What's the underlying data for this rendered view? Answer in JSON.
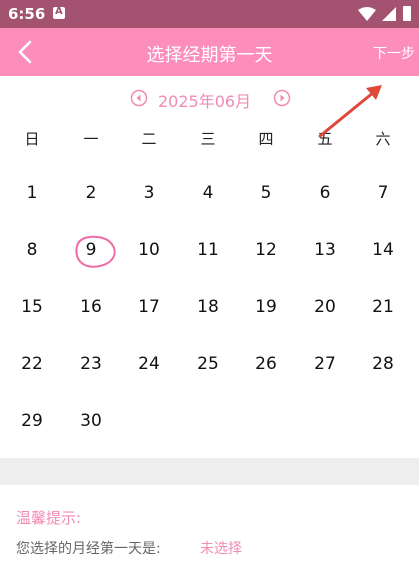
{
  "status": {
    "time": "6:56",
    "notif_letter": "A"
  },
  "toolbar": {
    "title": "选择经期第一天",
    "next_label": "下一步"
  },
  "calendar": {
    "month_label": "2025年06月",
    "weekdays": [
      "日",
      "一",
      "二",
      "三",
      "四",
      "五",
      "六"
    ],
    "days": [
      "1",
      "2",
      "3",
      "4",
      "5",
      "6",
      "7",
      "8",
      "9",
      "10",
      "11",
      "12",
      "13",
      "14",
      "15",
      "16",
      "17",
      "18",
      "19",
      "20",
      "21",
      "22",
      "23",
      "24",
      "25",
      "26",
      "27",
      "28",
      "29",
      "30"
    ],
    "selected_day": "9"
  },
  "tip": {
    "title": "温馨提示:",
    "label": "您选择的月经第一天是:",
    "value": "未选择"
  },
  "colors": {
    "status_bar": "#a3536f",
    "toolbar": "#fd8dba",
    "accent": "#f08cb4",
    "annotation_arrow": "#e0483a"
  }
}
